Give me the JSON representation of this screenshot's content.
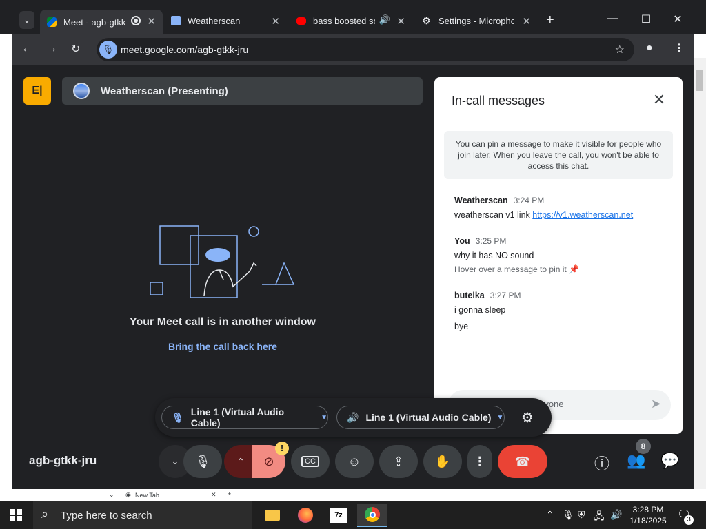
{
  "browser": {
    "tabs": [
      {
        "title": "Meet - agb-gtkk",
        "active": true
      },
      {
        "title": "Weatherscan",
        "active": false
      },
      {
        "title": "bass boosted sor",
        "active": false
      },
      {
        "title": "Settings - Microphon",
        "active": false
      }
    ],
    "new_tab": "+",
    "url": "meet.google.com/agb-gtkk-jru",
    "under_tab": "New Tab"
  },
  "meet": {
    "app_icon_text": "E|",
    "presenting": "Weatherscan (Presenting)",
    "another_window": "Your Meet call is in another window",
    "bring_back": "Bring the call back here",
    "meeting_code": "agb-gtkk-jru",
    "warning": "!",
    "people_count": "8",
    "audio": {
      "mic": "Line 1 (Virtual Audio Cable)",
      "speaker": "Line 1 (Virtual Audio Cable)"
    }
  },
  "chat": {
    "title": "In-call messages",
    "pin_note": "You can pin a message to make it visible for people who join later. When you leave the call, you won't be able to access this chat.",
    "messages": [
      {
        "sender": "Weatherscan",
        "time": "3:24 PM",
        "lines": [
          "weatherscan v1 link"
        ],
        "link": "https://v1.weatherscan.net"
      },
      {
        "sender": "You",
        "time": "3:25 PM",
        "lines": [
          "why it has NO sound"
        ],
        "hint": "Hover over a message to pin it"
      },
      {
        "sender": "butelka",
        "time": "3:27 PM",
        "lines": [
          "i gonna sleep",
          "bye"
        ]
      }
    ],
    "input_placeholder": "ryone"
  },
  "taskbar": {
    "search_placeholder": "Type here to search",
    "time": "3:28 PM",
    "date": "1/18/2025",
    "notif_count": "3",
    "apps": [
      "file-explorer",
      "firefox",
      "7zip",
      "chrome"
    ]
  },
  "colors": {
    "meet_bg": "#202124",
    "accent_blue": "#8ab4f8",
    "end_call": "#ea4335",
    "yellow": "#f9ab00"
  }
}
